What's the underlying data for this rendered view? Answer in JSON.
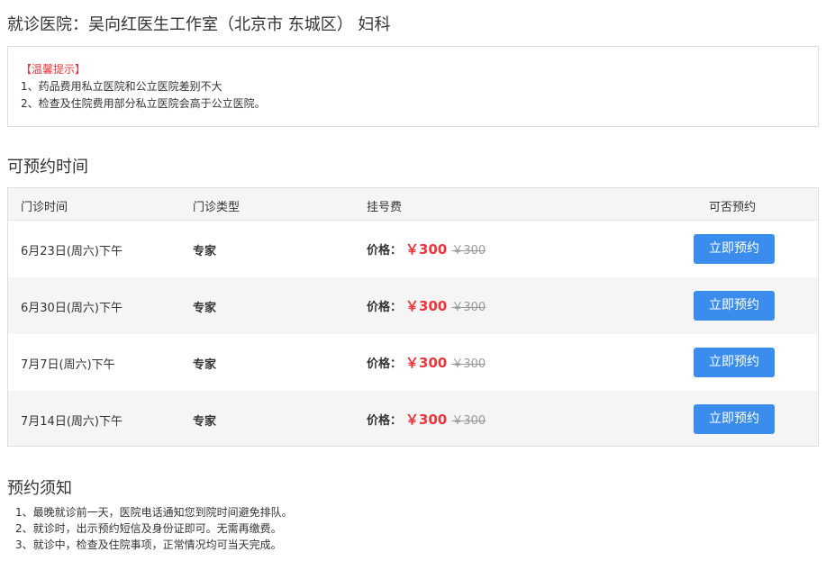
{
  "hospital": {
    "title": "就诊医院：吴向红医生工作室（北京市 东城区） 妇科"
  },
  "tips": {
    "heading": "【温馨提示】",
    "lines": [
      "1、药品费用私立医院和公立医院差别不大",
      "2、检查及住院费用部分私立医院会高于公立医院。"
    ]
  },
  "schedule": {
    "title": "可预约时间",
    "columns": [
      "门诊时间",
      "门诊类型",
      "挂号费",
      "可否预约"
    ],
    "rows": [
      {
        "date": "6月23日(周六)下午",
        "type": "专家",
        "price_label": "价格：",
        "price": "￥300",
        "original_price": "￥300",
        "button": "立即预约"
      },
      {
        "date": "6月30日(周六)下午",
        "type": "专家",
        "price_label": "价格：",
        "price": "￥300",
        "original_price": "￥300",
        "button": "立即预约"
      },
      {
        "date": "7月7日(周六)下午",
        "type": "专家",
        "price_label": "价格：",
        "price": "￥300",
        "original_price": "￥300",
        "button": "立即预约"
      },
      {
        "date": "7月14日(周六)下午",
        "type": "专家",
        "price_label": "价格：",
        "price": "￥300",
        "original_price": "￥300",
        "button": "立即预约"
      }
    ]
  },
  "notice": {
    "title": "预约须知",
    "lines": [
      "1、最晚就诊前一天，医院电话通知您到院时间避免排队。",
      "2、就诊时，出示预约短信及身份证即可。无需再缴费。",
      "3、就诊中，检查及住院事项，正常情况均可当天完成。"
    ]
  },
  "colors": {
    "accent": "#3b8ded",
    "price": "#e8373d",
    "tip_heading": "#e8373d",
    "row_alt": "#f5f5f5"
  }
}
